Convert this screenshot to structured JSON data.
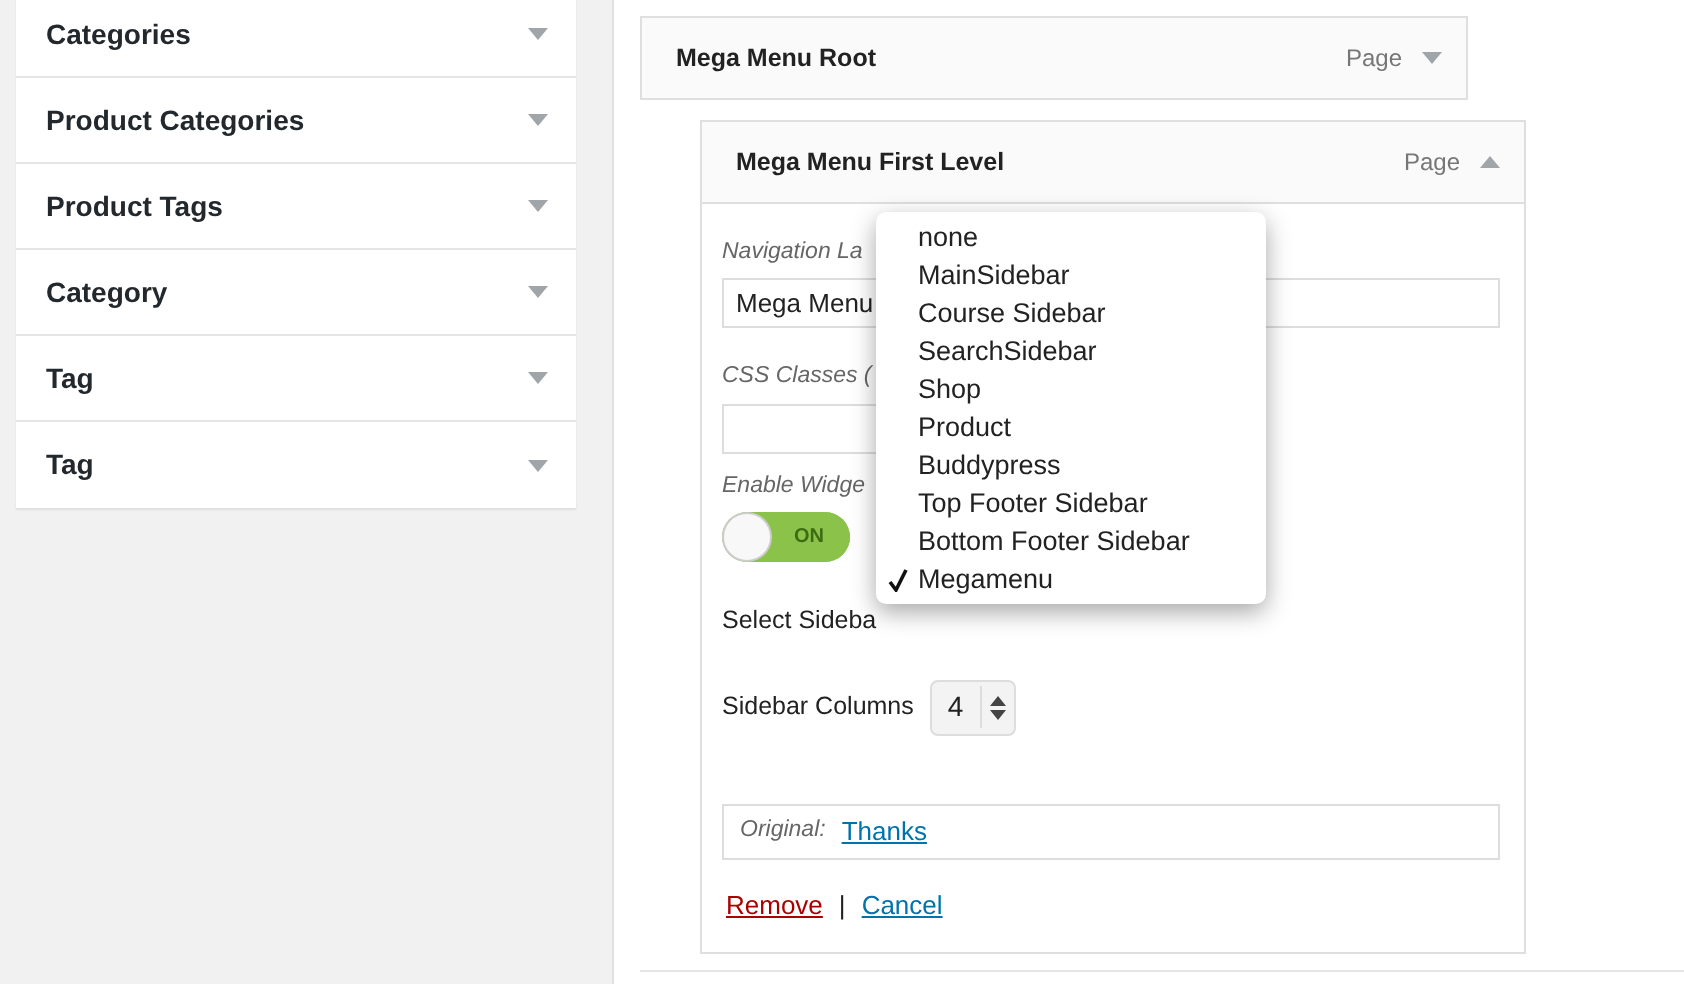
{
  "sidebar": {
    "items": [
      {
        "title": "Categories",
        "expanded": false
      },
      {
        "title": "Product Categories",
        "expanded": false
      },
      {
        "title": "Product Tags",
        "expanded": false
      },
      {
        "title": "Category",
        "expanded": false
      },
      {
        "title": "Tag",
        "expanded": false
      },
      {
        "title": "Tag",
        "expanded": false
      }
    ]
  },
  "menu_items": [
    {
      "title": "Mega Menu Root",
      "type_label": "Page",
      "expanded": false
    },
    {
      "title": "Mega Menu First Level",
      "type_label": "Page",
      "expanded": true,
      "navigation_label": {
        "label": "Navigation La",
        "value": "Mega Menu"
      },
      "css_classes": {
        "label": "CSS Classes ("
      },
      "enable_widgets": {
        "label": "Enable Widge",
        "toggle_text": "ON",
        "on": true
      },
      "select_sidebar": {
        "label": "Select Sideba"
      },
      "sidebar_columns": {
        "label": "Sidebar Columns",
        "value": "4"
      },
      "original": {
        "label": "Original:",
        "link": "Thanks"
      },
      "action_separator": "|",
      "actions": [
        {
          "label": "Remove",
          "kind": "delete"
        },
        {
          "label": "Cancel",
          "kind": "link"
        }
      ]
    }
  ],
  "dropdown": {
    "options": [
      {
        "label": "none",
        "selected": false
      },
      {
        "label": "MainSidebar",
        "selected": false
      },
      {
        "label": "Course Sidebar",
        "selected": false
      },
      {
        "label": "SearchSidebar",
        "selected": false
      },
      {
        "label": "Shop",
        "selected": false
      },
      {
        "label": "Product",
        "selected": false
      },
      {
        "label": "Buddypress",
        "selected": false
      },
      {
        "label": "Top Footer Sidebar",
        "selected": false
      },
      {
        "label": "Bottom Footer Sidebar",
        "selected": false
      },
      {
        "label": "Megamenu",
        "selected": true
      }
    ]
  }
}
